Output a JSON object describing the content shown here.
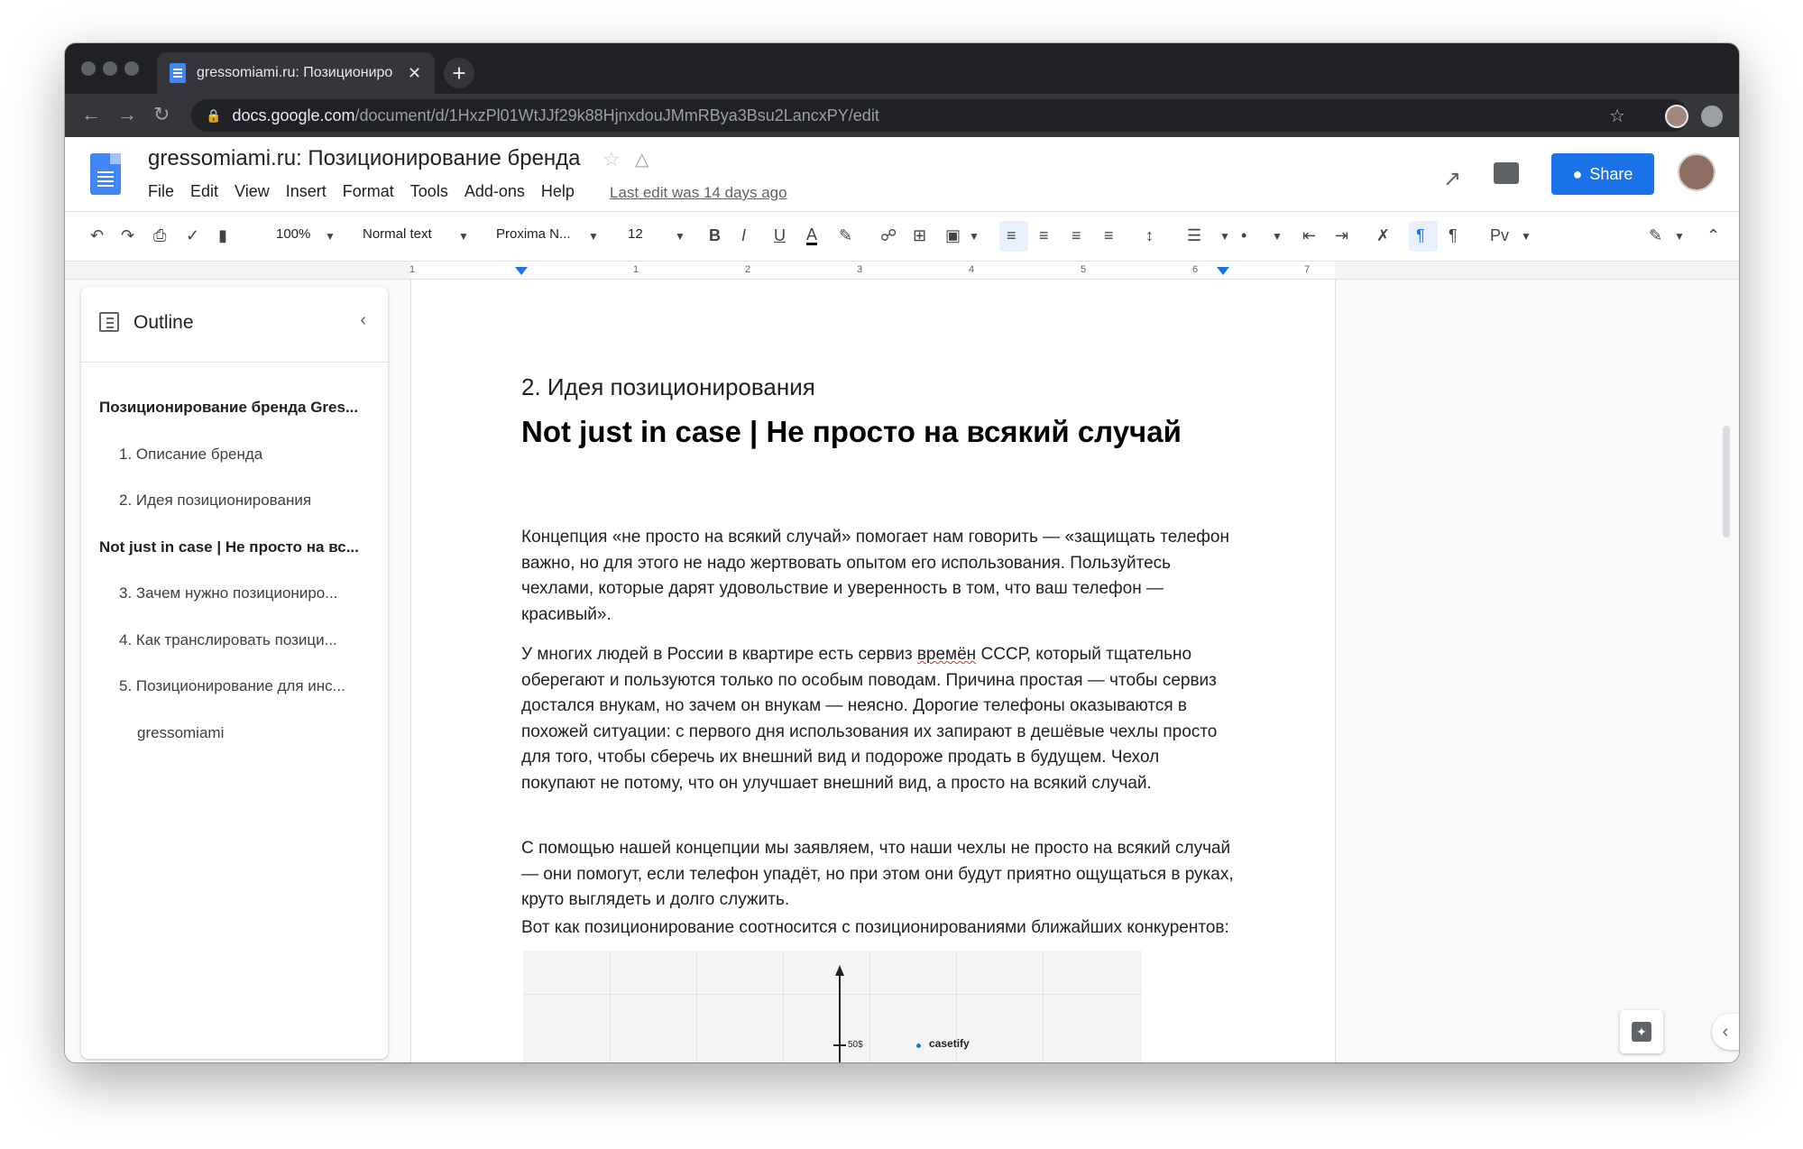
{
  "browser": {
    "tab_title": "gressomiami.ru: Позициониро",
    "tab_close": "✕",
    "new_tab": "+",
    "url_host": "docs.google.com",
    "url_path": "/document/d/1HxzPl01WtJJf29k88HjnxdouJMmRBya3Bsu2LancxPY/edit"
  },
  "docs": {
    "title": "gressomiami.ru: Позиционирование бренда",
    "menu": [
      "File",
      "Edit",
      "View",
      "Insert",
      "Format",
      "Tools",
      "Add-ons",
      "Help"
    ],
    "last_edit": "Last edit was 14 days ago",
    "share_label": "Share"
  },
  "toolbar": {
    "zoom": "100%",
    "style": "Normal text",
    "font": "Proxima N...",
    "font_size": "12",
    "bold": "B",
    "italic": "I",
    "underline": "U",
    "text_color": "A",
    "input_tools": "Рv"
  },
  "ruler": {
    "numbers": [
      "1",
      "1",
      "2",
      "3",
      "4",
      "5",
      "6",
      "7"
    ]
  },
  "outline": {
    "title": "Outline",
    "items": [
      "Позиционирование бренда Gres...",
      "1. Описание бренда",
      "2. Идея позиционирования",
      "Not just in case | Не просто на вс...",
      "3. Зачем нужно позициониро...",
      "4. Как транслировать позици...",
      "5. Позиционирование для инс...",
      "gressomiami"
    ]
  },
  "document": {
    "heading3": "2. Идея позиционирования",
    "heading1": "Not just in case | Не просто на всякий случай",
    "para1": "Концепция «не просто на всякий случай» помогает нам говорить — «защищать телефон важно, но для этого не надо жертвовать опытом его использования. Пользуйтесь чехлами, которые дарят удовольствие и уверенность в том, что ваш телефон — красивый».",
    "para2_before": "У многих людей в России в квартире есть сервиз ",
    "para2_flagged": "времён",
    "para2_after": " СССР, который тщательно оберегают и пользуются только по особым поводам. Причина простая — чтобы сервиз достался внукам, но зачем он внукам — неясно. Дорогие телефоны оказываются в похожей ситуации: с первого дня использования их запирают в дешёвые чехлы просто для того, чтобы сберечь их внешний вид и подороже продать в будущем. Чехол покупают не потому, что он улучшает внешний вид, а просто на всякий случай.",
    "para3": "С помощью нашей концепции мы заявляем, что наши чехлы не просто на всякий случай — они помогут, если телефон упадёт, но при этом они будут приятно ощущаться в руках, круто выглядеть и долго служить.",
    "para4": "Вот как позиционирование соотносится с позиционированиями ближайших конкурентов:"
  },
  "chart_data": {
    "type": "scatter",
    "y_tick_labels": [
      "50$"
    ],
    "points": [
      {
        "label": "casetify"
      }
    ]
  },
  "colors": {
    "accent": "#1a73e8",
    "chrome_dark": "#202124",
    "docs_blue": "#4285f4"
  }
}
